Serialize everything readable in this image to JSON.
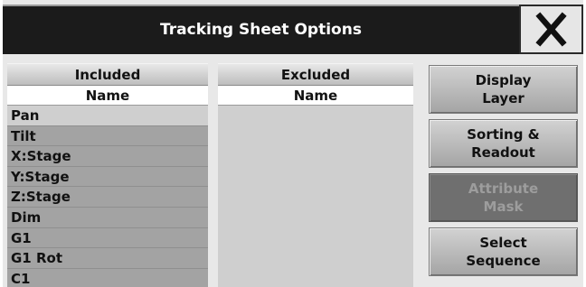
{
  "window": {
    "title": "Tracking Sheet Options",
    "close_icon": "close-x-icon"
  },
  "included": {
    "header": "Included",
    "column": "Name",
    "rows": [
      "Pan",
      "Tilt",
      "X:Stage",
      "Y:Stage",
      "Z:Stage",
      "Dim",
      "G1",
      "G1 Rot",
      "C1"
    ]
  },
  "excluded": {
    "header": "Excluded",
    "column": "Name",
    "rows": []
  },
  "buttons": {
    "display_layer": "Display\nLayer",
    "sorting_readout": "Sorting &\nReadout",
    "attribute_mask": "Attribute\nMask",
    "select_sequence": "Select\nSequence"
  },
  "colors": {
    "title_bar": "#1b1b1b",
    "disabled_button": "#6f6f6f"
  }
}
